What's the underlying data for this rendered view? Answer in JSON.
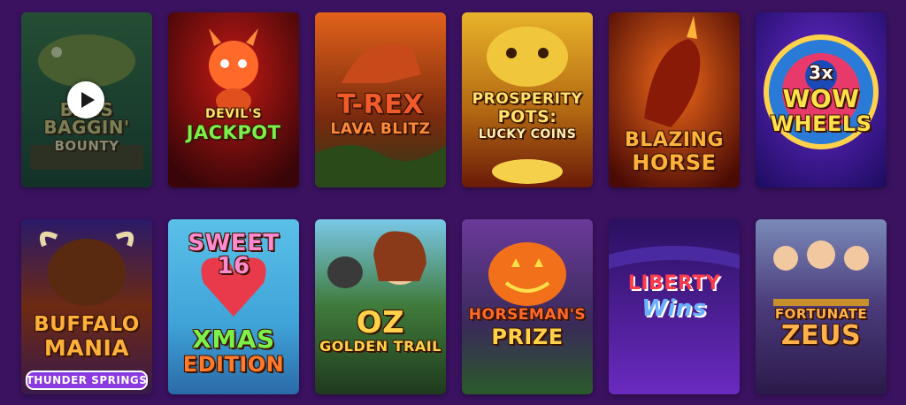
{
  "games": [
    {
      "id": "bass",
      "lines": [
        "BASS",
        "BAGGIN'",
        "BOUNTY"
      ],
      "bg": "#1f4a3a",
      "bg2": "#5b6b2a",
      "text": "#d8c77a"
    },
    {
      "id": "devil",
      "lines": [
        "DEVIL'S",
        "JACKPOT",
        ""
      ],
      "bg": "#7a0f10",
      "bg2": "#2a0508",
      "text": "#ffd84a"
    },
    {
      "id": "trex",
      "lines": [
        "T-REX",
        "LAVA BLITZ",
        ""
      ],
      "bg": "#b2360f",
      "bg2": "#2d3a16",
      "text": "#f25a2a"
    },
    {
      "id": "prosperity",
      "lines": [
        "PROSPERITY",
        "POTS:",
        "LUCKY COINS"
      ],
      "bg": "#c58a12",
      "bg2": "#7a1d0a",
      "text": "#ffe26a"
    },
    {
      "id": "horse",
      "lines": [
        "BLAZING",
        "HORSE",
        ""
      ],
      "bg": "#b0270a",
      "bg2": "#3e0a05",
      "text": "#ffb23a"
    },
    {
      "id": "wow",
      "lines": [
        "3x",
        "WOW",
        "WHEELS"
      ],
      "bg": "#4b1a9a",
      "bg2": "#1a0b5c",
      "text": "#ffe14a"
    },
    {
      "id": "buffalo",
      "lines": [
        "BUFFALO",
        "MANIA",
        "THUNDER SPRINGS"
      ],
      "bg": "#6d2a12",
      "bg2": "#2a1a4a",
      "text": "#ffb03a"
    },
    {
      "id": "sweet",
      "lines": [
        "SWEET 16",
        "XMAS",
        "EDITION"
      ],
      "bg": "#3fa3d8",
      "bg2": "#d24a6e",
      "text": "#ffe04a"
    },
    {
      "id": "oz",
      "lines": [
        "OZ",
        "GOLDEN TRAIL",
        ""
      ],
      "bg": "#3f7a3a",
      "bg2": "#1f3a1e",
      "text": "#ffd24a"
    },
    {
      "id": "horseman",
      "lines": [
        "HORSEMAN'S",
        "PRIZE",
        ""
      ],
      "bg": "#5a2f7a",
      "bg2": "#3a6a2a",
      "text": "#ff6a2a"
    },
    {
      "id": "liberty",
      "lines": [
        "LIBERTY",
        "Wins",
        ""
      ],
      "bg": "#3b1a8a",
      "bg2": "#5a2ab0",
      "text": "#ff3a4a"
    },
    {
      "id": "zeus",
      "lines": [
        "FORTUNATE",
        "ZEUS",
        ""
      ],
      "bg": "#5a6a9a",
      "bg2": "#3a2a5a",
      "text": "#ffb14a"
    }
  ],
  "colors": {
    "page_bg": "#3a1260",
    "play": "#ffffff"
  },
  "icons": {
    "play": "play-icon"
  }
}
